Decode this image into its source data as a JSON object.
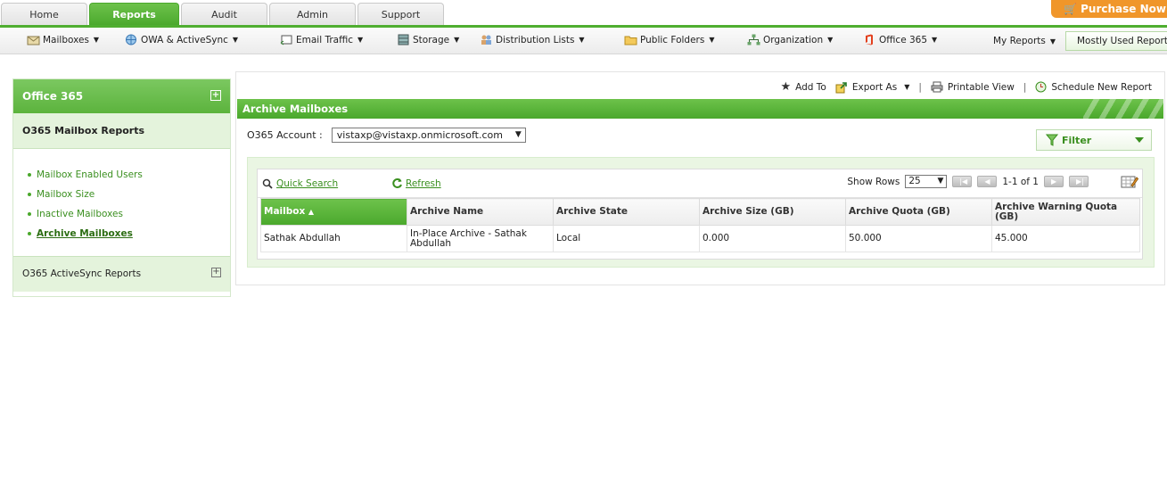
{
  "top_tabs": [
    "Home",
    "Reports",
    "Audit",
    "Admin",
    "Support"
  ],
  "active_tab": "Reports",
  "purchase_label": "Purchase Now",
  "submenu": {
    "mailboxes": "Mailboxes",
    "owa": "OWA & ActiveSync",
    "email_traffic": "Email Traffic",
    "storage": "Storage",
    "distribution_lists": "Distribution Lists",
    "public_folders": "Public Folders",
    "organization": "Organization",
    "office365": "Office 365",
    "my_reports": "My Reports",
    "mostly_used": "Mostly Used Reports"
  },
  "sidebar": {
    "title": "Office 365",
    "section": "O365 Mailbox Reports",
    "items": [
      {
        "label": "Mailbox Enabled Users"
      },
      {
        "label": "Mailbox Size"
      },
      {
        "label": "Inactive Mailboxes"
      },
      {
        "label": "Archive Mailboxes"
      }
    ],
    "section2": "O365 ActiveSync Reports"
  },
  "toolbar": {
    "add_to": "Add To",
    "export_as": "Export As",
    "printable_view": "Printable View",
    "schedule": "Schedule New Report"
  },
  "report": {
    "title": "Archive Mailboxes",
    "account_label": "O365 Account :",
    "account_value": "vistaxp@vistaxp.onmicrosoft.com",
    "filter_label": "Filter",
    "quick_search": "Quick Search",
    "refresh": "Refresh",
    "show_rows_label": "Show Rows",
    "rows_value": "25",
    "page_info": "1-1 of 1"
  },
  "table": {
    "columns": [
      "Mailbox",
      "Archive Name",
      "Archive State",
      "Archive Size (GB)",
      "Archive Quota (GB)",
      "Archive Warning Quota (GB)"
    ],
    "rows": [
      [
        "Sathak Abdullah",
        "In-Place Archive - Sathak Abdullah",
        "Local",
        "0.000",
        "50.000",
        "45.000"
      ]
    ]
  },
  "colors": {
    "accent_green": "#4aa82c",
    "purchase_orange": "#f0962a"
  }
}
